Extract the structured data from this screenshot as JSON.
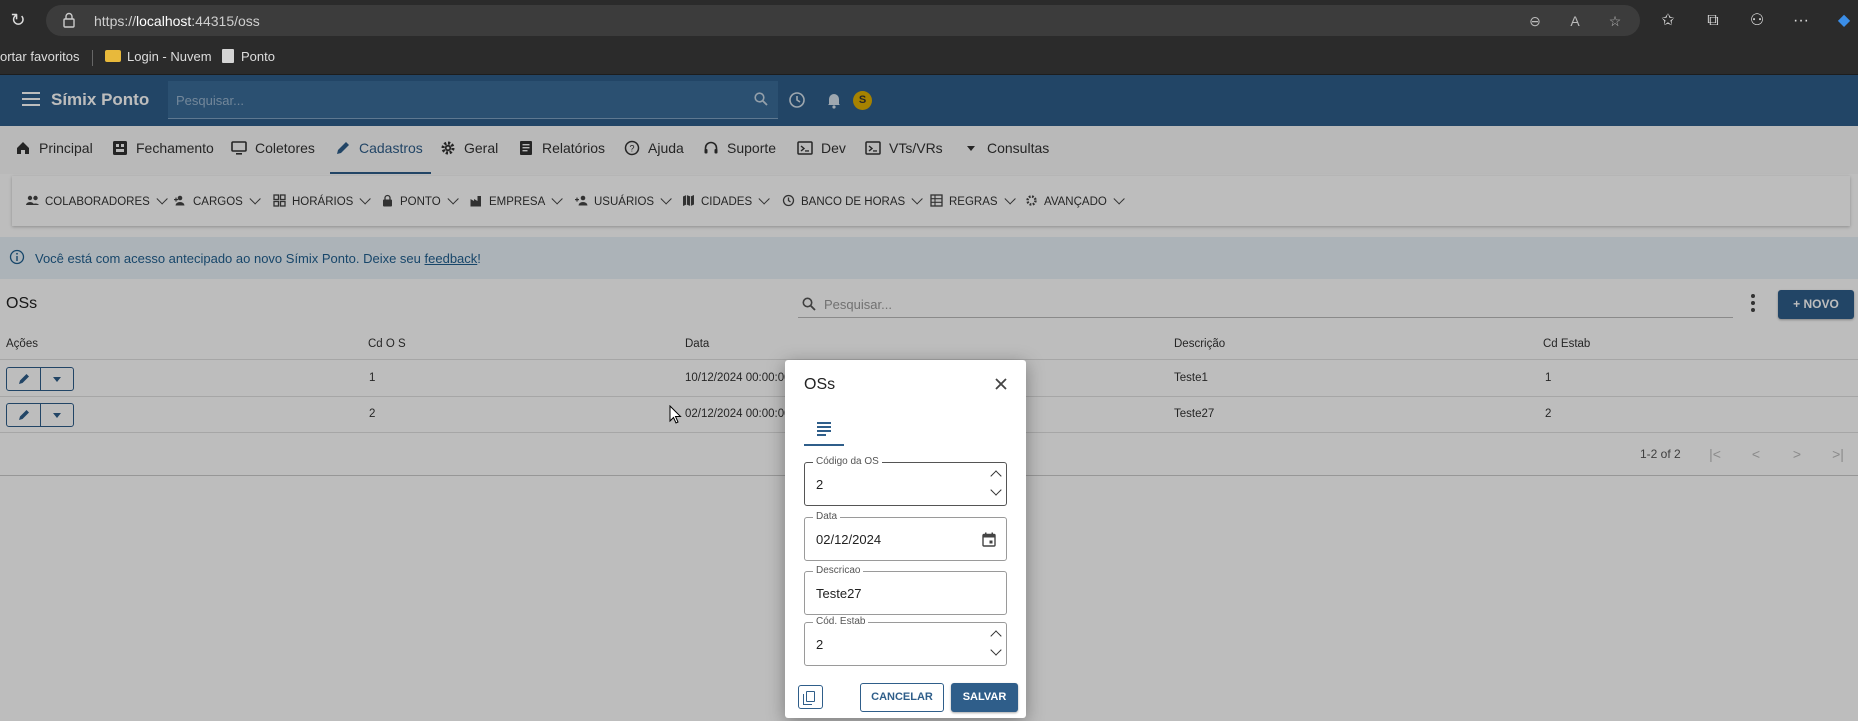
{
  "browser": {
    "url_prefix": "https://",
    "url_host": "localhost",
    "url_rest": ":44315/oss",
    "bookmarks": {
      "import_favorites": "ortar favoritos",
      "folder_login": "Login - Nuvem",
      "page_ponto": "Ponto"
    }
  },
  "header": {
    "app_name": "Símix Ponto",
    "search_placeholder": "Pesquisar...",
    "avatar_initial": "S",
    "accent_color": "#2f5e8a",
    "badge_color": "#e0b000"
  },
  "main_nav": [
    {
      "label": "Principal",
      "icon": "home-icon"
    },
    {
      "label": "Fechamento",
      "icon": "dashboard-icon"
    },
    {
      "label": "Coletores",
      "icon": "monitor-icon"
    },
    {
      "label": "Cadastros",
      "icon": "pencil-icon",
      "active": true
    },
    {
      "label": "Geral",
      "icon": "gear-icon"
    },
    {
      "label": "Relatórios",
      "icon": "document-icon"
    },
    {
      "label": "Ajuda",
      "icon": "help-icon"
    },
    {
      "label": "Suporte",
      "icon": "headset-icon"
    },
    {
      "label": "Dev",
      "icon": "terminal-icon"
    },
    {
      "label": "VTs/VRs",
      "icon": "terminal-icon"
    },
    {
      "label": "Consultas",
      "icon": "caret-down-icon"
    }
  ],
  "sub_nav": [
    {
      "label": "COLABORADORES",
      "icon": "people-icon"
    },
    {
      "label": "CARGOS",
      "icon": "group-add-icon"
    },
    {
      "label": "HORÁRIOS",
      "icon": "grid-icon"
    },
    {
      "label": "PONTO",
      "icon": "lock-icon"
    },
    {
      "label": "EMPRESA",
      "icon": "factory-icon"
    },
    {
      "label": "USUÁRIOS",
      "icon": "person-add-icon"
    },
    {
      "label": "CIDADES",
      "icon": "map-icon"
    },
    {
      "label": "BANCO DE HORAS",
      "icon": "history-icon"
    },
    {
      "label": "REGRAS",
      "icon": "table-icon"
    },
    {
      "label": "AVANÇADO",
      "icon": "gear-icon"
    }
  ],
  "notice": {
    "text": "Você está com acesso antecipado ao novo Símix Ponto. Deixe seu ",
    "link": "feedback",
    "tail": "!"
  },
  "list": {
    "title": "OSs",
    "search_placeholder": "Pesquisar...",
    "new_button": "NOVO",
    "columns": [
      "Ações",
      "Cd O S",
      "Data",
      "Descrição",
      "Cd Estab"
    ],
    "rows": [
      {
        "cd_os": "1",
        "data": "10/12/2024 00:00:00",
        "descricao": "Teste1",
        "cd_estab": "1"
      },
      {
        "cd_os": "2",
        "data": "02/12/2024 00:00:00",
        "descricao": "Teste27",
        "cd_estab": "2"
      }
    ],
    "pagination": "1-2 of 2"
  },
  "dialog": {
    "title": "OSs",
    "fields": {
      "codigo_label": "Código da OS",
      "codigo_value": "2",
      "data_label": "Data",
      "data_value": "02/12/2024",
      "descricao_label": "Descricao",
      "descricao_value": "Teste27",
      "estab_label": "Cód. Estab",
      "estab_value": "2"
    },
    "cancel": "CANCELAR",
    "save": "SALVAR"
  }
}
